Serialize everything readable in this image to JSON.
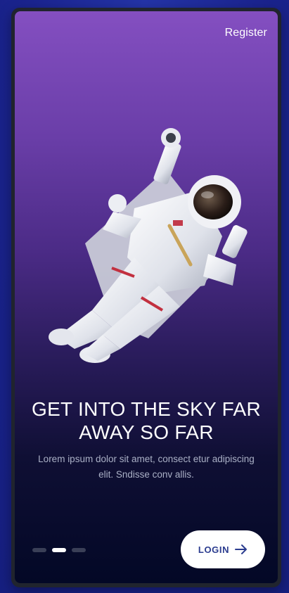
{
  "header": {
    "register_label": "Register"
  },
  "hero": {
    "image_icon": "astronaut-illustration",
    "title": "GET INTO THE SKY FAR AWAY SO FAR",
    "description": "Lorem ipsum dolor sit amet, consect etur adipiscing elit. Sndisse conv allis."
  },
  "pager": {
    "total": 3,
    "active_index": 1
  },
  "actions": {
    "login_label": "LOGIN",
    "login_icon": "arrow-right-icon"
  },
  "colors": {
    "page_background": "#1c2796",
    "gradient_top": "#844fc1",
    "gradient_bottom": "#030826",
    "button_text": "#2b3c8f",
    "dot_active": "#ffffff",
    "dot_inactive": "#3a3f57"
  }
}
